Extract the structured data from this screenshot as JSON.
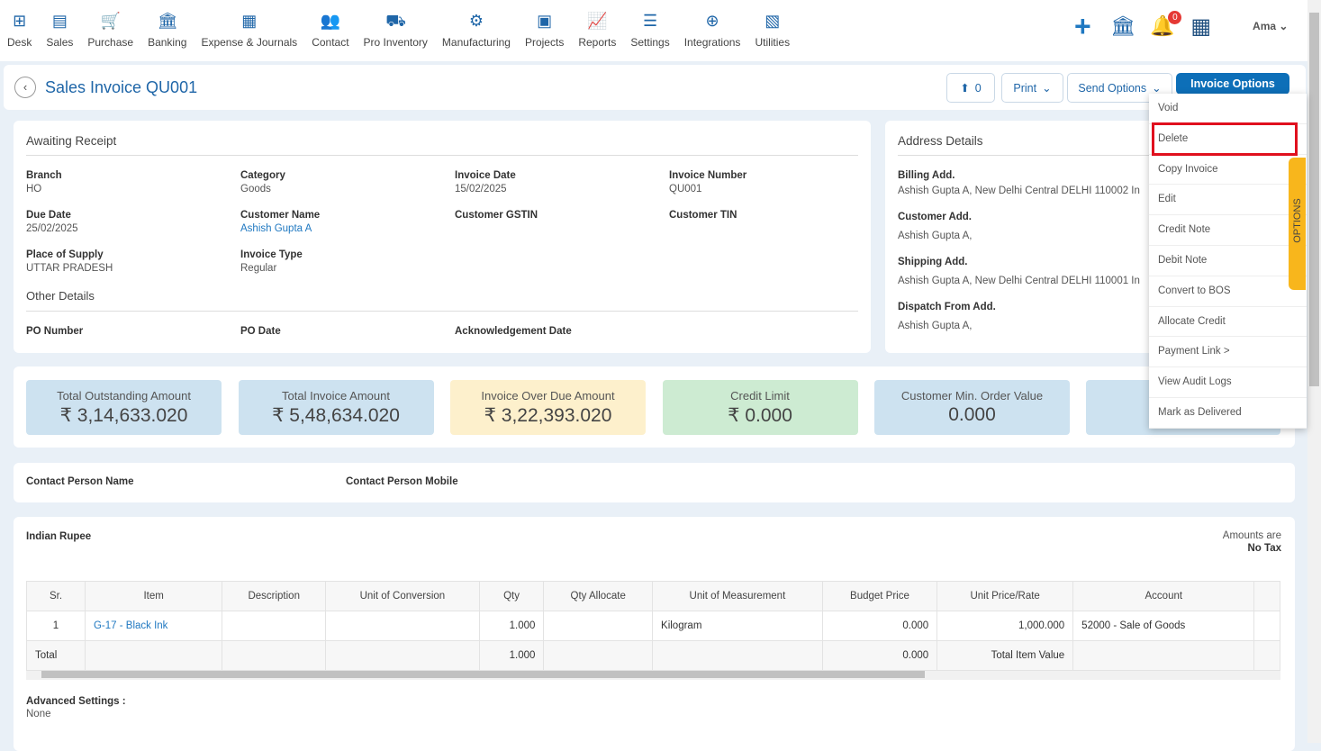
{
  "nav": [
    {
      "label": "Desk",
      "icon": "desk-icon",
      "glyph": "⊞"
    },
    {
      "label": "Sales",
      "icon": "sales-icon",
      "glyph": "▤"
    },
    {
      "label": "Purchase",
      "icon": "cart-icon",
      "glyph": "🛒"
    },
    {
      "label": "Banking",
      "icon": "bank-icon",
      "glyph": "🏛"
    },
    {
      "label": "Expense & Journals",
      "icon": "journal-icon",
      "glyph": "▦"
    },
    {
      "label": "Contact",
      "icon": "contact-icon",
      "glyph": "👥"
    },
    {
      "label": "Pro Inventory",
      "icon": "inventory-icon",
      "glyph": "⛟"
    },
    {
      "label": "Manufacturing",
      "icon": "manufacturing-icon",
      "glyph": "⚙"
    },
    {
      "label": "Projects",
      "icon": "projects-icon",
      "glyph": "▣"
    },
    {
      "label": "Reports",
      "icon": "reports-icon",
      "glyph": "📈"
    },
    {
      "label": "Settings",
      "icon": "settings-icon",
      "glyph": "☰"
    },
    {
      "label": "Integrations",
      "icon": "integrations-icon",
      "glyph": "⊕"
    },
    {
      "label": "Utilities",
      "icon": "utilities-icon",
      "glyph": "▧"
    }
  ],
  "topbar": {
    "notification_count": "0",
    "user": "Ama"
  },
  "header": {
    "title": "Sales Invoice QU001",
    "attach_count": "0",
    "print": "Print",
    "send_options": "Send Options",
    "invoice_options": "Invoice Options"
  },
  "menu": [
    "Void",
    "Delete",
    "Copy Invoice",
    "Edit",
    "Credit Note",
    "Debit Note",
    "Convert to BOS",
    "Allocate Credit",
    "Payment Link >",
    "View Audit Logs",
    "Mark as Delivered"
  ],
  "options_tab": "OPTIONS",
  "details": {
    "status": "Awaiting Receipt",
    "branch_l": "Branch",
    "branch": "HO",
    "category_l": "Category",
    "category": "Goods",
    "inv_date_l": "Invoice Date",
    "inv_date": "15/02/2025",
    "inv_no_l": "Invoice Number",
    "inv_no": "QU001",
    "due_l": "Due Date",
    "due": "25/02/2025",
    "cust_l": "Customer Name",
    "cust": "Ashish Gupta A",
    "gstin_l": "Customer GSTIN",
    "tin_l": "Customer TIN",
    "pos_l": "Place of Supply",
    "pos": "UTTAR PRADESH",
    "type_l": "Invoice Type",
    "type": "Regular",
    "other": "Other Details",
    "po_l": "PO Number",
    "podate_l": "PO Date",
    "ack_l": "Acknowledgement Date"
  },
  "address": {
    "title": "Address Details",
    "billing_l": "Billing Add.",
    "billing": "Ashish Gupta A, New Delhi Central DELHI 110002 In",
    "customer_l": "Customer Add.",
    "customer": "Ashish Gupta A,",
    "shipping_l": "Shipping Add.",
    "shipping": "Ashish Gupta A, New Delhi Central DELHI 110001 In",
    "dispatch_l": "Dispatch From Add.",
    "dispatch": "Ashish Gupta A,"
  },
  "stats": [
    {
      "title": "Total Outstanding Amount",
      "value": "₹ 3,14,633.020",
      "color": "#cde2f0"
    },
    {
      "title": "Total Invoice Amount",
      "value": "₹ 5,48,634.020",
      "color": "#cde2f0"
    },
    {
      "title": "Invoice Over Due Amount",
      "value": "₹ 3,22,393.020",
      "color": "#fdf0cc"
    },
    {
      "title": "Credit Limit",
      "value": "₹ 0.000",
      "color": "#cdebd2"
    },
    {
      "title": "Customer Min. Order Value",
      "value": "0.000",
      "color": "#cde2f0"
    }
  ],
  "contact": {
    "name_l": "Contact Person Name",
    "mobile_l": "Contact Person Mobile"
  },
  "items": {
    "currency": "Indian Rupee",
    "amounts_are": "Amounts are",
    "tax": "No Tax",
    "columns": [
      "Sr.",
      "Item",
      "Description",
      "Unit of Conversion",
      "Qty",
      "Qty Allocate",
      "Unit of Measurement",
      "Budget Price",
      "Unit Price/Rate",
      "Account"
    ],
    "rows": [
      [
        "1",
        "G-17 - Black Ink",
        "",
        "",
        "1.000",
        "",
        "Kilogram",
        "0.000",
        "1,000.000",
        "52000 - Sale of Goods"
      ]
    ],
    "total": [
      "Total",
      "",
      "",
      "",
      "1.000",
      "",
      "",
      "0.000",
      "Total Item Value",
      ""
    ]
  },
  "advanced": {
    "label": "Advanced Settings :",
    "value": "None"
  }
}
